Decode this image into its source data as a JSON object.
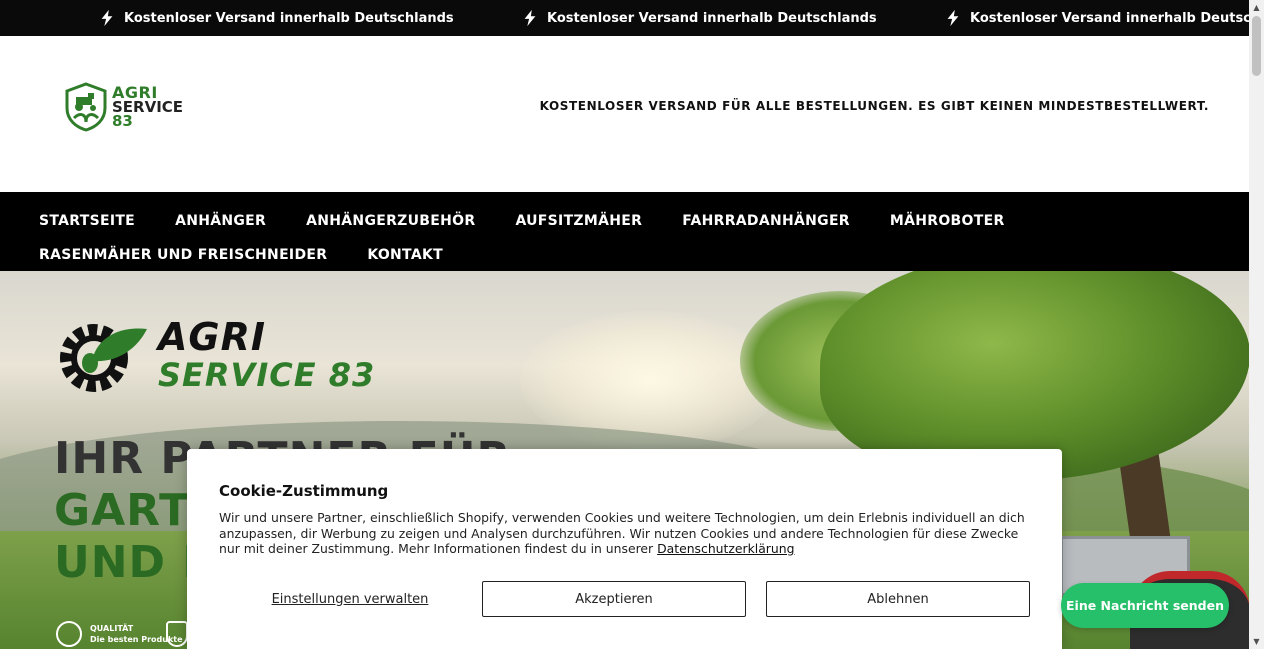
{
  "announcement": {
    "items": [
      "Kostenloser Versand innerhalb Deutschlands",
      "Kostenloser Versand innerhalb Deutschlands",
      "Kostenloser Versand innerhalb Deutschlands"
    ],
    "icon": "lightning-bolt-icon"
  },
  "header": {
    "logo": {
      "line1": "AGRI",
      "line2": "SERVICE",
      "line3": "83"
    },
    "message": "KOSTENLOSER VERSAND FÜR ALLE BESTELLUNGEN. ES GIBT KEINEN MINDESTBESTELLWERT."
  },
  "nav": {
    "row1": [
      "STARTSEITE",
      "ANHÄNGER",
      "ANHÄNGERZUBEHÖR",
      "AUFSITZMÄHER",
      "FAHRRADANHÄNGER",
      "MÄHROBOTER"
    ],
    "row2": [
      "RASENMÄHER UND FREISCHNEIDER",
      "KONTAKT"
    ]
  },
  "hero": {
    "logo": {
      "line1": "AGRI",
      "line2": "SERVICE 83"
    },
    "headline": {
      "line1": "IHR PARTNER FÜR",
      "line2": "GARTEN",
      "line3": "UND M"
    },
    "badge": {
      "title": "QUALITÄT",
      "subtitle": "Die besten Produkte"
    }
  },
  "cookie": {
    "title": "Cookie-Zustimmung",
    "text": "Wir und unsere Partner, einschließlich Shopify, verwenden Cookies und weitere Technologien, um dein Erlebnis individuell an dich anzupassen, dir Werbung zu zeigen und Analysen durchzuführen. Wir nutzen Cookies und andere Technologien für diese Zwecke nur mit deiner Zustimmung. Mehr Informationen findest du in unserer ",
    "link": "Datenschutzerklärung",
    "manage": "Einstellungen verwalten",
    "accept": "Akzeptieren",
    "decline": "Ablehnen"
  },
  "chat": {
    "label": "Eine Nachricht senden"
  },
  "colors": {
    "brand_green": "#2f7d2a",
    "chat_green": "#27c06a",
    "nav_bg": "#000000"
  }
}
